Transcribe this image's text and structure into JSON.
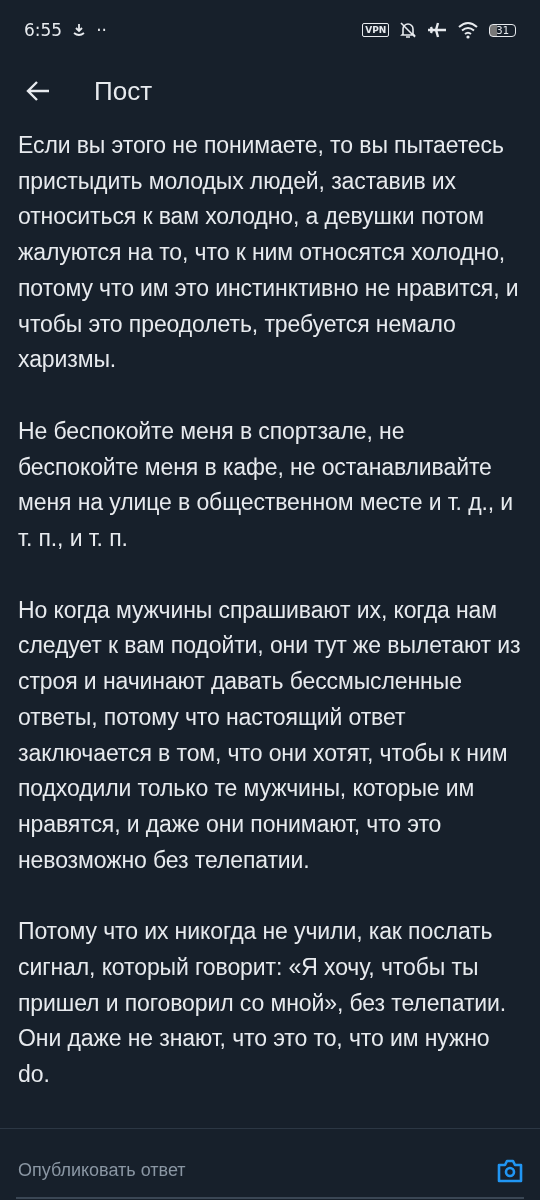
{
  "status_bar": {
    "time": "6:55",
    "dots": "··",
    "vpn": "VPN",
    "battery": "31"
  },
  "header": {
    "title": "Пост"
  },
  "paragraphs": [
    "Если вы этого не понимаете, то вы пытаетесь пристыдить молодых людей, заставив их относиться к вам холодно, а девушки потом жалуются на то, что к ним относятся холодно, потому что им это инстинктивно не нравится, и чтобы это преодолеть, требуется немало харизмы.",
    "Не беспокойте меня в спортзале, не беспокойте меня в кафе, не останавливайте меня на улице в общественном месте и т. д., и т. п., и т. п.",
    "Но когда мужчины спрашивают их, когда нам следует к вам подойти, они тут же вылетают из строя и начинают давать бессмысленные ответы, потому что настоящий ответ заключается в том, что они хотят, чтобы к ним подходили только те мужчины, которые им нравятся, и даже они понимают, что это невозможно без телепатии.",
    "Потому что их никогда не учили, как послать сигнал, который говорит: «Я хочу, чтобы ты пришел и поговорил со мной», без телепатии. Они даже не знают, что это то, что им нужно do."
  ],
  "reply": {
    "placeholder": "Опубликовать ответ"
  }
}
